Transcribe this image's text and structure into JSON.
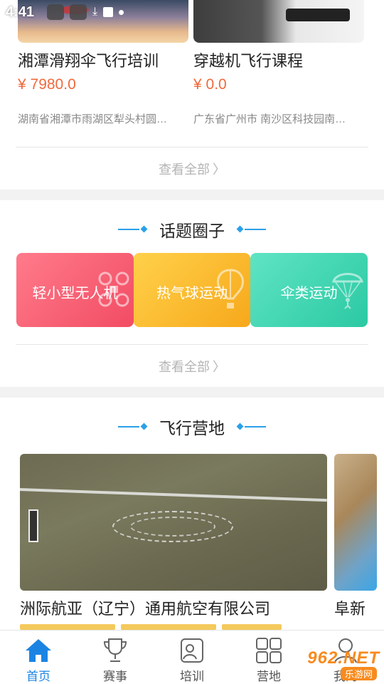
{
  "status_bar": {
    "time": "4:41"
  },
  "courses": [
    {
      "title": "湘潭滑翔伞飞行培训",
      "price": "¥ 7980.0",
      "address": "湖南省湘潭市雨湖区犁头村圆…"
    },
    {
      "title": "穿越机飞行课程",
      "price": "¥ 0.0",
      "address": "广东省广州市 南沙区科技园南…"
    }
  ],
  "view_all": "查看全部",
  "topics_section": {
    "title": "话题圈子",
    "items": [
      {
        "label": "轻小型无人机",
        "icon": "drone-icon",
        "color": "#f24c63"
      },
      {
        "label": "热气球运动",
        "icon": "hot-air-balloon-icon",
        "color": "#f7a81b"
      },
      {
        "label": "伞类运动",
        "icon": "parachute-icon",
        "color": "#2bc9a3"
      }
    ]
  },
  "camps_section": {
    "title": "飞行营地",
    "items": [
      {
        "title": "洲际航亚（辽宁）通用航空有限公司"
      },
      {
        "title": "阜新"
      }
    ]
  },
  "bottom_nav": [
    {
      "label": "首页",
      "icon": "home-icon",
      "active": true
    },
    {
      "label": "赛事",
      "icon": "trophy-icon",
      "active": false
    },
    {
      "label": "培训",
      "icon": "training-icon",
      "active": false
    },
    {
      "label": "营地",
      "icon": "camp-icon",
      "active": false
    },
    {
      "label": "我的",
      "icon": "user-icon",
      "active": false
    }
  ],
  "watermark": {
    "brand": "962.NET",
    "sub": "乐游网"
  },
  "colors": {
    "accent": "#1b84e3",
    "price": "#f06a3c",
    "deco": "#2aa0e8"
  }
}
